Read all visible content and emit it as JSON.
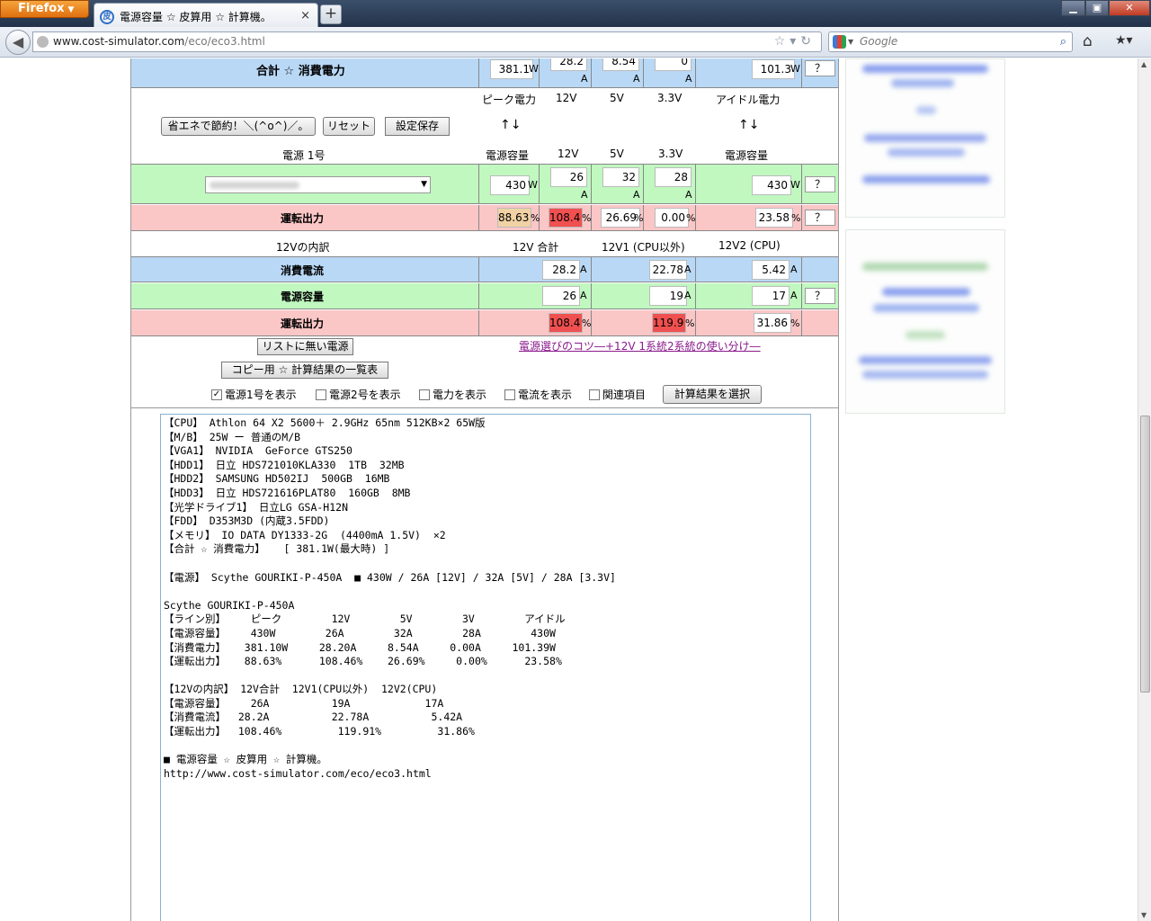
{
  "browser": {
    "firefox_label": "Firefox",
    "tab_title": "電源容量 ☆ 皮算用 ☆ 計算機。",
    "tab_close": "×",
    "new_tab": "+",
    "url_domain": "www.cost-simulator.com",
    "url_path": "/eco/eco3.html",
    "search_placeholder": "Google",
    "window_buttons": [
      "▁",
      "▣",
      "✕"
    ]
  },
  "total_row": {
    "label": "合計 ☆ 消費電力",
    "peak": "381.1",
    "v12": "28.2",
    "v5": "8.54",
    "v33": "0",
    "idle": "101.3",
    "unit_w": "W",
    "unit_a": "A",
    "help": "？"
  },
  "header1": {
    "peak": "ピーク電力",
    "v12": "12V",
    "v5": "5V",
    "v33": "3.3V",
    "idle": "アイドル電力",
    "arrows": "↑↓"
  },
  "buttons": {
    "save_energy": "省エネで節約！＼(^o^)／。",
    "reset": "リセット",
    "save_settings": "設定保存",
    "no_list": "リストに無い電源",
    "copy_list": "コピー用 ☆ 計算結果の一覧表",
    "select_result": "計算結果を選択"
  },
  "psu_header": {
    "label": "電源 1号",
    "capacity": "電源容量",
    "v12": "12V",
    "v5": "5V",
    "v33": "3.3V",
    "capacity2": "電源容量"
  },
  "psu_row": {
    "capacity": "430",
    "v12": "26",
    "v5": "32",
    "v33": "28",
    "capacity2": "430"
  },
  "load_row": {
    "label": "運転出力",
    "peak": "88.63",
    "v12": "108.4",
    "v5": "26.69",
    "v33": "0.00",
    "idle": "23.58",
    "unit_pct": "%"
  },
  "split_header": {
    "label": "12Vの内訳",
    "total": "12V 合計",
    "v1": "12V1 (CPU以外)",
    "v2": "12V2 (CPU)"
  },
  "split_rows": {
    "current_label": "消費電流",
    "current": [
      "28.2",
      "22.78",
      "5.42"
    ],
    "capacity_label": "電源容量",
    "capacity": [
      "26",
      "19",
      "17"
    ],
    "load_label": "運転出力",
    "load": [
      "108.4",
      "119.9",
      "31.86"
    ]
  },
  "link_text": "電源選びのコツ―+12V 1系統2系統の使い分け―",
  "checkboxes": [
    {
      "label": "電源1号を表示",
      "checked": true
    },
    {
      "label": "電源2号を表示",
      "checked": false
    },
    {
      "label": "電力を表示",
      "checked": false
    },
    {
      "label": "電流を表示",
      "checked": false
    },
    {
      "label": "関連項目",
      "checked": false
    }
  ],
  "result_text": "【CPU】 Athlon 64 X2 5600＋ 2.9GHz 65nm 512KB×2 65W版\n【M/B】 25W ー 普通のM/B\n【VGA1】 NVIDIA  GeForce GTS250\n【HDD1】 日立 HDS721010KLA330  1TB  32MB\n【HDD2】 SAMSUNG HD502IJ  500GB  16MB\n【HDD3】 日立 HDS721616PLAT80  160GB  8MB\n【光学ドライブ1】 日立LG GSA-H12N\n【FDD】 D353M3D (内蔵3.5FDD)\n【メモリ】 IO DATA DY1333-2G  (4400mA 1.5V)  ×2\n【合計 ☆ 消費電力】   [ 381.1W(最大時) ]\n\n【電源】 Scythe GOURIKI-P-450A  ■ 430W / 26A [12V] / 32A [5V] / 28A [3.3V]\n\nScythe GOURIKI-P-450A\n【ライン別】    ピーク        12V        5V        3V        アイドル\n【電源容量】    430W        26A        32A        28A        430W\n【消費電力】   381.10W     28.20A     8.54A     0.00A     101.39W\n【運転出力】   88.63%      108.46%    26.69%     0.00%      23.58%\n\n【12Vの内訳】 12V合計  12V1(CPU以外)  12V2(CPU)\n【電源容量】    26A          19A            17A\n【消費電流】  28.2A          22.78A          5.42A\n【運転出力】  108.46%         119.91%         31.86%\n\n■ 電源容量 ☆ 皮算用 ☆ 計算機。\nhttp://www.cost-simulator.com/eco/eco3.html"
}
